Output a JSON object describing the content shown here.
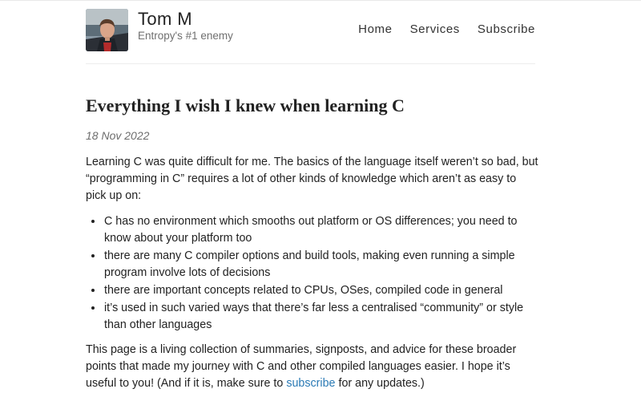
{
  "site": {
    "title": "Tom M",
    "tagline": "Entropy's #1 enemy",
    "avatar_alt": "avatar"
  },
  "nav": {
    "items": [
      "Home",
      "Services",
      "Subscribe"
    ]
  },
  "post": {
    "title": "Everything I wish I knew when learning C",
    "date": "18 Nov 2022",
    "intro": "Learning C was quite difficult for me. The basics of the language itself weren’t so bad, but “programming in C” requires a lot of other kinds of knowledge which aren’t as easy to pick up on:",
    "bullets": [
      "C has no environment which smooths out platform or OS differences; you need to know about your platform too",
      "there are many C compiler options and build tools, making even running a simple program involve lots of decisions",
      "there are important concepts related to CPUs, OSes, compiled code in general",
      "it’s used in such varied ways that there’s far less a centralised “community” or style than other languages"
    ],
    "closing_before": "This page is a living collection of summaries, signposts, and advice for these broader points that made my journey with C and other compiled languages easier. I hope it’s useful to you! (And if it is, make sure to ",
    "closing_link": "subscribe",
    "closing_after": " for any updates.)"
  },
  "colors": {
    "link": "#2a7ab5",
    "muted": "#707070",
    "text": "#222222"
  }
}
